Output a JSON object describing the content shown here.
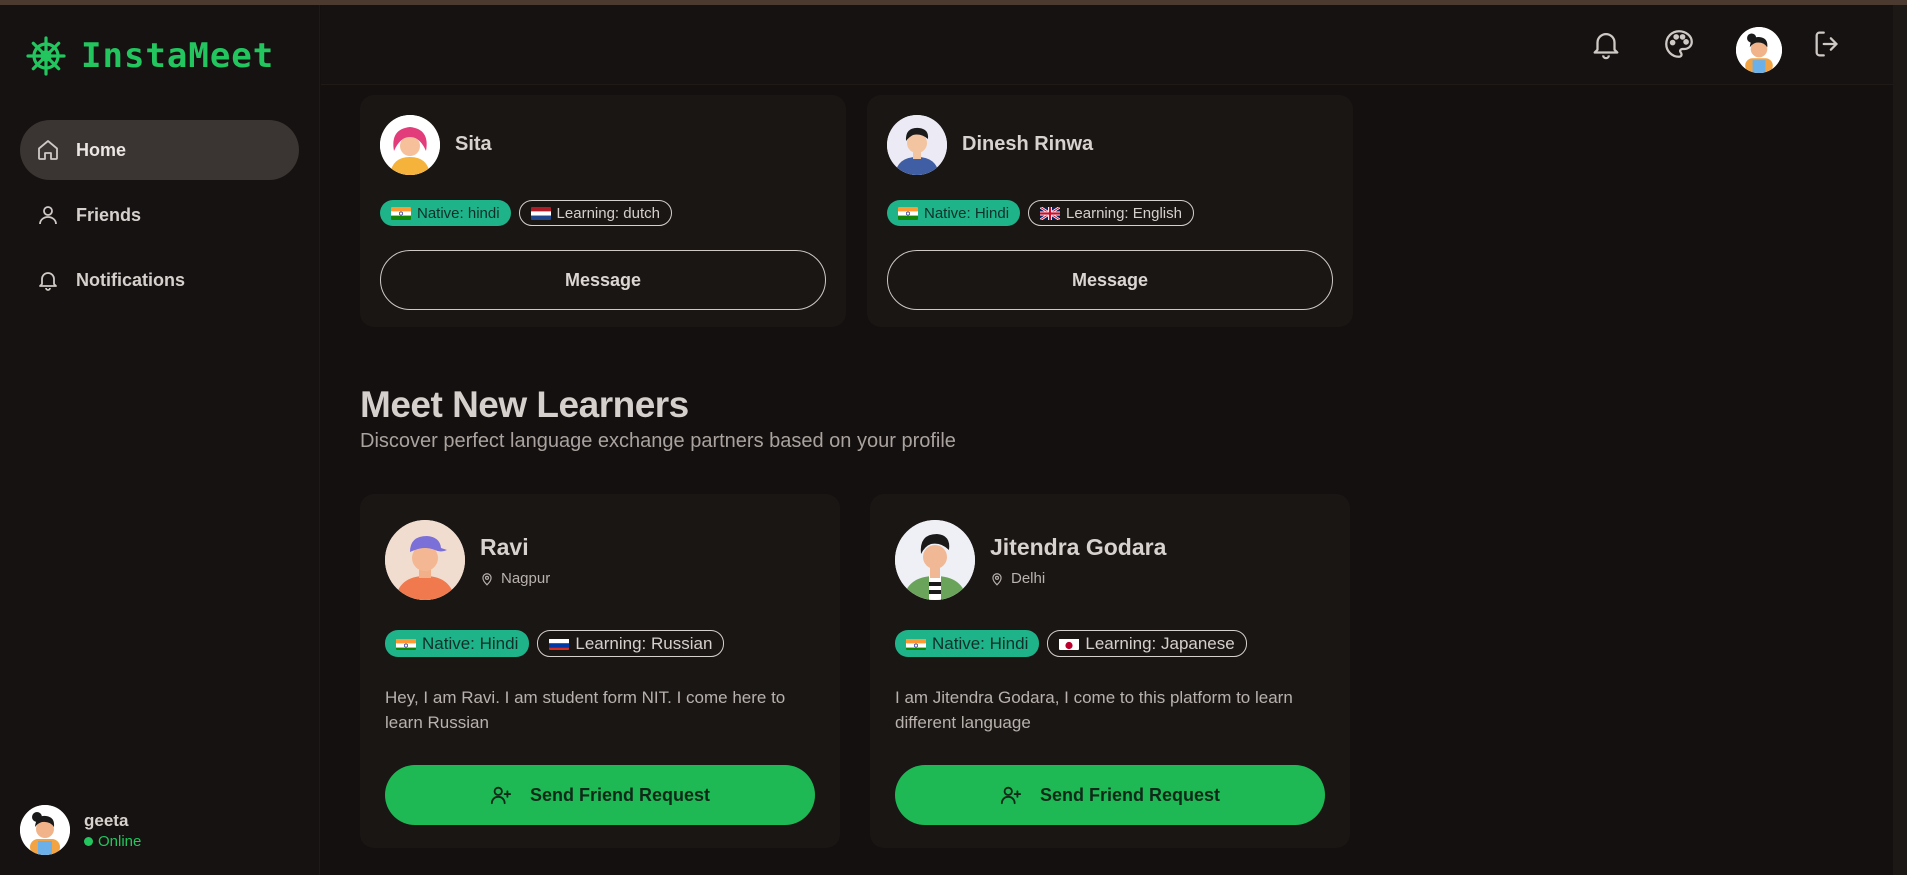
{
  "app": {
    "name": "InstaMeet",
    "accent": "#22c55e"
  },
  "sidebar": {
    "items": [
      {
        "label": "Home",
        "icon": "home-icon",
        "active": true
      },
      {
        "label": "Friends",
        "icon": "user-icon",
        "active": false
      },
      {
        "label": "Notifications",
        "icon": "bell-icon",
        "active": false
      }
    ],
    "user": {
      "name": "geeta",
      "status": "Online"
    }
  },
  "header": {
    "icons": [
      "bell-icon",
      "palette-icon",
      "avatar",
      "logout-icon"
    ]
  },
  "friends": [
    {
      "name": "Sita",
      "native": "Native: hindi",
      "learning": "Learning: dutch",
      "native_flag": "india",
      "learning_flag": "netherlands",
      "button": "Message"
    },
    {
      "name": "Dinesh Rinwa",
      "native": "Native: Hindi",
      "learning": "Learning: English",
      "native_flag": "india",
      "learning_flag": "uk",
      "button": "Message"
    }
  ],
  "section": {
    "title": "Meet New Learners",
    "subtitle": "Discover perfect language exchange partners based on your profile"
  },
  "learners": [
    {
      "name": "Ravi",
      "location": "Nagpur",
      "native": "Native: Hindi",
      "learning": "Learning: Russian",
      "native_flag": "india",
      "learning_flag": "russia",
      "bio": "Hey, I am Ravi. I am student form NIT. I come here to learn Russian",
      "button": "Send Friend Request"
    },
    {
      "name": "Jitendra Godara",
      "location": "Delhi",
      "native": "Native: Hindi",
      "learning": "Learning: Japanese",
      "native_flag": "india",
      "learning_flag": "japan",
      "bio": "I am Jitendra Godara, I come to this platform to learn different language",
      "button": "Send Friend Request"
    }
  ]
}
